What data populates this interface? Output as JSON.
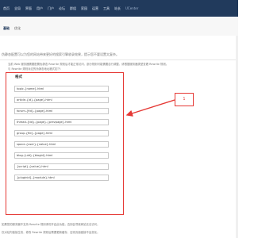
{
  "topbar": {
    "nav_items": [
      "首页",
      "全局",
      "界面",
      "用户",
      "门户",
      "论坛",
      "群组",
      "家园",
      "运营",
      "工具",
      "站长"
    ],
    "brand": "UCenter"
  },
  "subtabs": {
    "active": "基础",
    "other": "优化"
  },
  "notes": {
    "line1": "伪静态配置可以为您的网站带来更好的搜索引擎收录效果，提示您不要设置太复杂。",
    "line2": "当前 Web 服务器需要配置伪静态 Rewrite 规则后才能正常访问，部分规则可能需要自行调整，请根据服务器类型查看 Rewrite 规则。",
    "line3": "与 Rewrite 规则对应的伪静态地址格式如下：",
    "footer1": "如果您的服务器不支持 Rewrite 规则请勿开启此功能，否则会导致网站无法访问。",
    "footer2": "仅对站内链接生效，修改 Rewrite 规则后需要更新缓存，否则页面链接不会变化。"
  },
  "panel": {
    "title": "格式",
    "fields": [
      "topic-{name}.html",
      "article-{id}-{page}.html",
      "forum-{fid}-{page}.html",
      "thread-{tid}-{page}-{prevpage}.html",
      "group-{fid}-{page}.html",
      "space-{user}-{value}.html",
      "blog-{uid}-{blogid}.html",
      "{script}-{value}.html",
      "{pluginid}-{module}.html"
    ]
  },
  "callout": {
    "label": "1"
  },
  "colors": {
    "topbar": "#213a5c",
    "highlight": "#e53935"
  }
}
